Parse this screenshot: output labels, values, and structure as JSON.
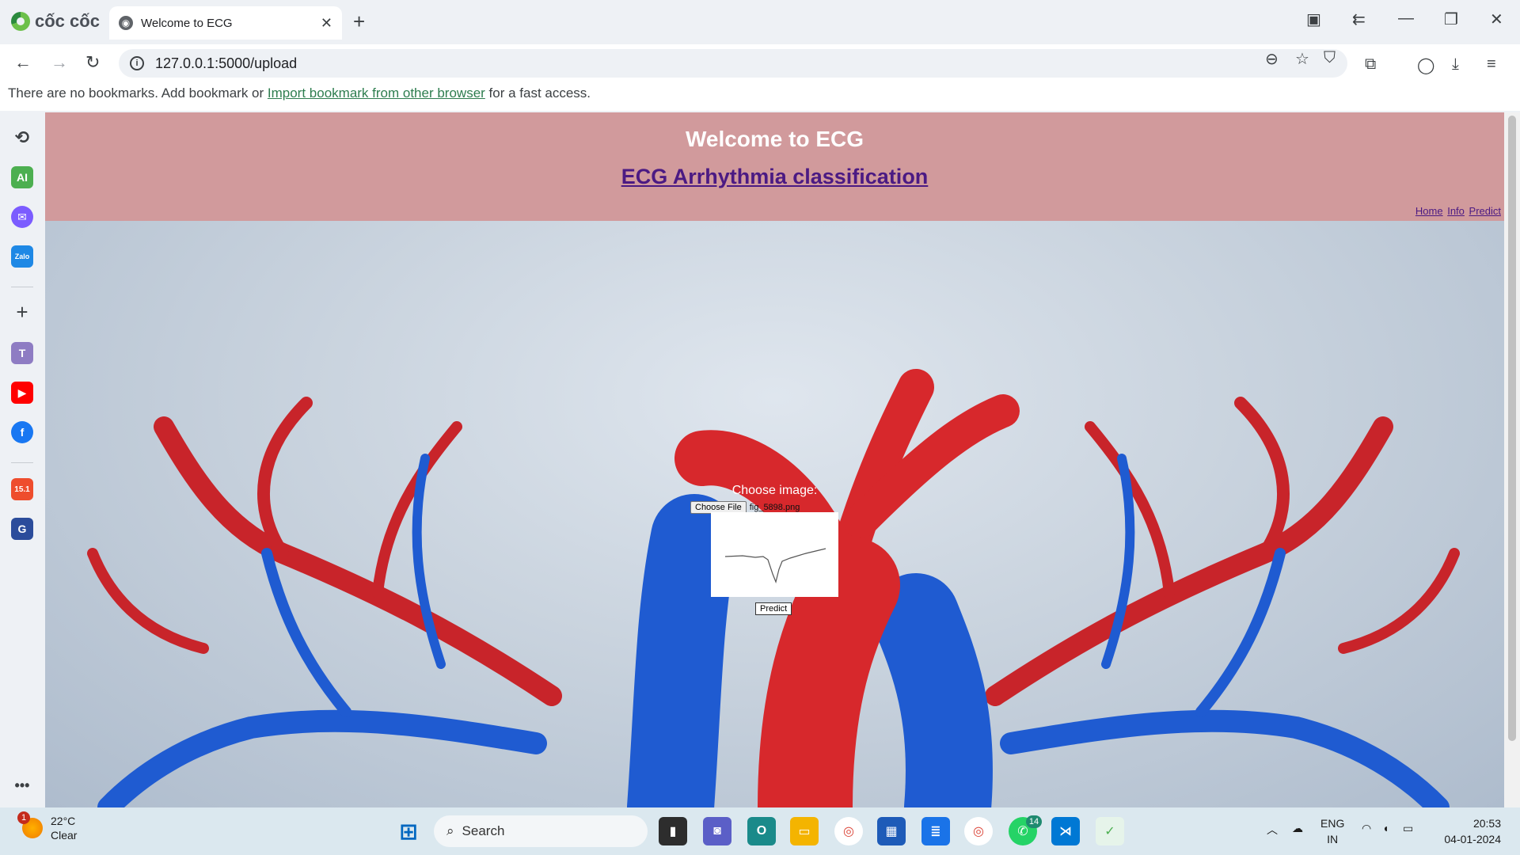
{
  "browser": {
    "brand": "cốc cốc",
    "tab_title": "Welcome to ECG",
    "url": "127.0.0.1:5000/upload",
    "bookmarks_text_before": "There are no bookmarks. Add bookmark or ",
    "bookmarks_link": "Import bookmark from other browser",
    "bookmarks_text_after": " for a fast access."
  },
  "sidebar": {
    "items": [
      "history-icon",
      "ai-icon",
      "messenger-icon",
      "zalo-icon",
      "add-icon",
      "t-app-icon",
      "youtube-icon",
      "facebook-icon",
      "shopee-icon",
      "game-icon"
    ],
    "ai_label": "AI",
    "zalo_label": "Zalo",
    "t_label": "T",
    "shop_label": "15.1",
    "more_label": "•••"
  },
  "page": {
    "title": "Welcome to ECG",
    "subtitle_link": "ECG Arrhythmia classification",
    "nav": [
      "Home",
      "Info",
      "Predict"
    ],
    "upload_label": "Choose image:",
    "choose_file_button": "Choose File",
    "file_name": "fig_5898.png",
    "predict_button": "Predict"
  },
  "taskbar": {
    "weather_badge": "1",
    "temperature": "22°C",
    "condition": "Clear",
    "search_placeholder": "Search",
    "whatsapp_badge": "14",
    "language": "ENG",
    "region": "IN",
    "time": "20:53",
    "date": "04-01-2024"
  },
  "colors": {
    "header_bg": "#d19a9c",
    "link": "#4b1a83"
  }
}
